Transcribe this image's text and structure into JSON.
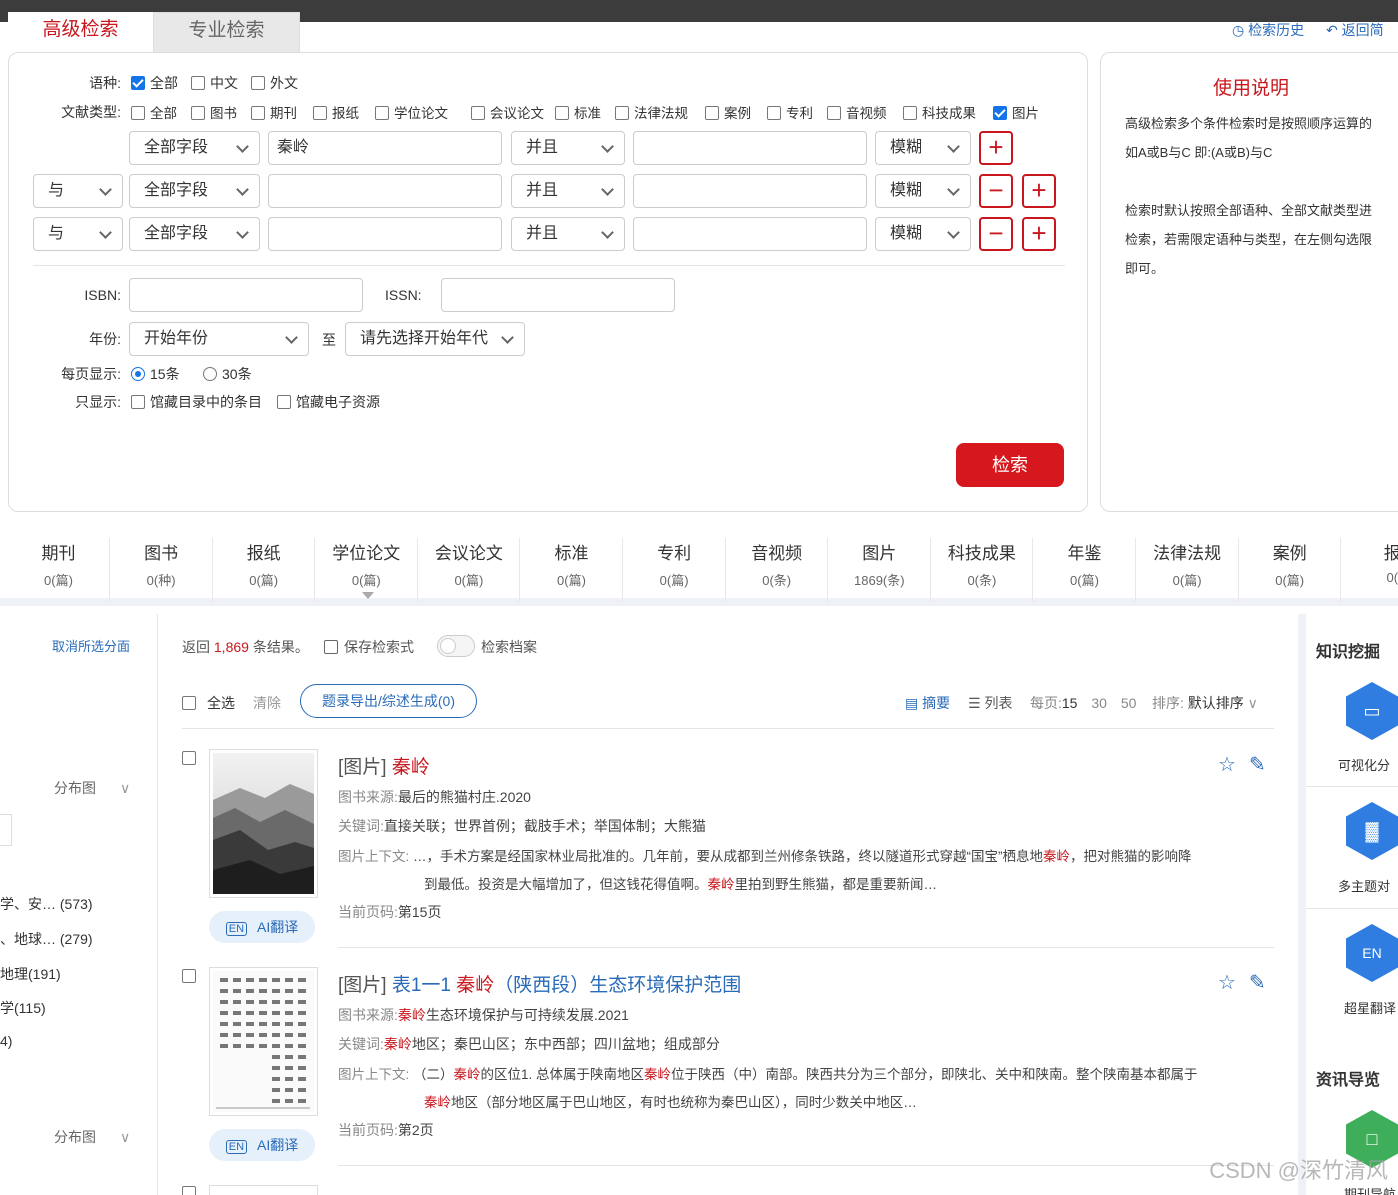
{
  "tabs": {
    "advanced": "高级检索",
    "professional": "专业检索"
  },
  "toplinks": {
    "history": "检索历史",
    "back": "返回简"
  },
  "form": {
    "language_label": "语种:",
    "languages": [
      {
        "label": "全部",
        "checked": true
      },
      {
        "label": "中文",
        "checked": false
      },
      {
        "label": "外文",
        "checked": false
      }
    ],
    "doctype_label": "文献类型:",
    "doctypes": [
      {
        "label": "全部",
        "checked": false
      },
      {
        "label": "图书",
        "checked": false
      },
      {
        "label": "期刊",
        "checked": false
      },
      {
        "label": "报纸",
        "checked": false
      },
      {
        "label": "学位论文",
        "checked": false
      },
      {
        "label": "会议论文",
        "checked": false
      },
      {
        "label": "标准",
        "checked": false
      },
      {
        "label": "法律法规",
        "checked": false
      },
      {
        "label": "案例",
        "checked": false
      },
      {
        "label": "专利",
        "checked": false
      },
      {
        "label": "音视频",
        "checked": false
      },
      {
        "label": "科技成果",
        "checked": false
      },
      {
        "label": "图片",
        "checked": true
      }
    ],
    "rows": [
      {
        "logic": "",
        "field": "全部字段",
        "value": "秦岭",
        "op": "并且",
        "value2": "",
        "mode": "模糊"
      },
      {
        "logic": "与",
        "field": "全部字段",
        "value": "",
        "op": "并且",
        "value2": "",
        "mode": "模糊"
      },
      {
        "logic": "与",
        "field": "全部字段",
        "value": "",
        "op": "并且",
        "value2": "",
        "mode": "模糊"
      }
    ],
    "isbn_label": "ISBN:",
    "issn_label": "ISSN:",
    "year_label": "年份:",
    "year_start": "开始年份",
    "year_to": "至",
    "year_end": "请先选择开始年代",
    "perpage_label": "每页显示:",
    "perpage_options": [
      {
        "label": "15条",
        "checked": true
      },
      {
        "label": "30条",
        "checked": false
      }
    ],
    "only_label": "只显示:",
    "only_options": [
      {
        "label": "馆藏目录中的条目",
        "checked": false
      },
      {
        "label": "馆藏电子资源",
        "checked": false
      }
    ],
    "search_button": "检索"
  },
  "help": {
    "title": "使用说明",
    "lines": [
      "高级检索多个条件检索时是按照顺序运算的",
      "如A或B与C 即:(A或B)与C",
      "",
      "检索时默认按照全部语种、全部文献类型进",
      "检索，若需限定语种与类型，在左侧勾选限",
      "即可。"
    ]
  },
  "categories": [
    {
      "name": "期刊",
      "count": "0(篇)"
    },
    {
      "name": "图书",
      "count": "0(种)"
    },
    {
      "name": "报纸",
      "count": "0(篇)"
    },
    {
      "name": "学位论文",
      "count": "0(篇)"
    },
    {
      "name": "会议论文",
      "count": "0(篇)"
    },
    {
      "name": "标准",
      "count": "0(篇)"
    },
    {
      "name": "专利",
      "count": "0(篇)"
    },
    {
      "name": "音视频",
      "count": "0(条)"
    },
    {
      "name": "图片",
      "count": "1869(条)"
    },
    {
      "name": "科技成果",
      "count": "0(条)"
    },
    {
      "name": "年鉴",
      "count": "0(篇)"
    },
    {
      "name": "法律法规",
      "count": "0(篇)"
    },
    {
      "name": "案例",
      "count": "0(篇)"
    },
    {
      "name": "报",
      "count": "0("
    }
  ],
  "sidebar": {
    "cancel_facets": "取消所选分面",
    "dist1": "分布图",
    "facets": [
      "学、安…  (573)",
      "、地球…  (279)",
      "地理(191)",
      "学(115)",
      "4)"
    ],
    "dist2": "分布图"
  },
  "results_bar": {
    "prefix": "返回",
    "count": "1,869",
    "suffix": "条结果。",
    "save": "保存检索式",
    "archive": "检索档案",
    "select_all": "全选",
    "clear": "清除",
    "export": "题录导出/综述生成(0)",
    "view_abstract": "摘要",
    "view_list": "列表",
    "perpage_label": "每页:",
    "perpage_values": [
      "15",
      "30",
      "50"
    ],
    "sort_label": "排序:",
    "sort_value": "默认排序"
  },
  "results": [
    {
      "prefix": "[图片]",
      "title_parts": [
        {
          "t": "秦岭",
          "hl": true
        }
      ],
      "source_label": "图书来源:",
      "source": "最后的熊猫村庄.2020",
      "keywords_label": "关键词:",
      "keywords": "直接关联；世界首例；截肢手术；举国体制；大熊猫",
      "context_label": "图片上下文:",
      "context1": "…，手术方案是经国家林业局批准的。几年前，要从成都到兰州修条铁路，终以隧道形式穿越“国宝”栖息地",
      "context1_hl": "秦岭",
      "context1_tail": "，把对熊猫的影响降",
      "context2": "到最低。投资是大幅增加了，但这钱花得值啊。",
      "context2_hl": "秦岭",
      "context2_tail": "里拍到野生熊猫，都是重要新闻…",
      "page_label": "当前页码:",
      "page": "第15页",
      "ai": "AI翻译"
    },
    {
      "prefix": "[图片]",
      "title_a": "表1一1 ",
      "title_hl": "秦岭",
      "title_b": "（陕西段）生态环境保护范围",
      "source_label": "图书来源:",
      "source_hl": "秦岭",
      "source": "生态环境保护与可持续发展.2021",
      "keywords_label": "关键词:",
      "keywords_hl": "秦岭",
      "keywords": "地区；秦巴山区；东中西部；四川盆地；组成部分",
      "context_label": "图片上下文:",
      "context1": "（二）",
      "context1_hl": "秦岭",
      "context1_mid": "的区位1. 总体属于陕南地区",
      "context1_hl2": "秦岭",
      "context1_tail": "位于陕西（中）南部。陕西共分为三个部分，即陕北、关中和陕南。整个陕南基本都属于",
      "context2_hl": "秦岭",
      "context2_tail": "地区（部分地区属于巴山地区，有时也统称为秦巴山区），同时少数关中地区…",
      "page_label": "当前页码:",
      "page": "第2页",
      "ai": "AI翻译"
    }
  ],
  "right_panel": {
    "title1": "知识挖掘",
    "items": [
      "可视化分",
      "多主题对",
      "超星翻译"
    ],
    "title2": "资讯导览",
    "item4": "期刊导航"
  },
  "watermark": "CSDN @深竹清风",
  "colors": {
    "brand_red": "#c8171e",
    "link_blue": "#2a6bb8",
    "checkbox_blue": "#1473e6"
  }
}
